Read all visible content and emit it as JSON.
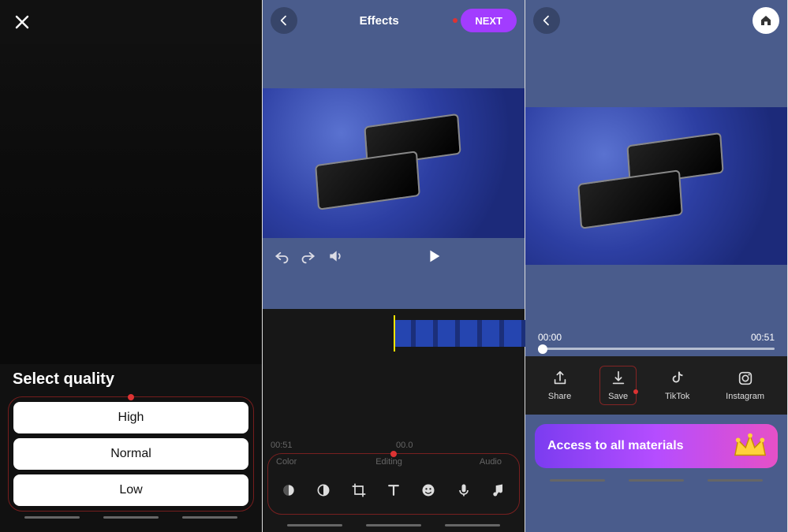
{
  "panel1": {
    "title": "Select quality",
    "options": [
      "High",
      "Normal",
      "Low"
    ]
  },
  "panel2": {
    "headerTitle": "Effects",
    "nextLabel": "NEXT",
    "timeLeft": "00:51",
    "timeRight": "00.0",
    "toolGroups": [
      "Color",
      "Editing",
      "Audio"
    ],
    "toolIcons": [
      "brightness",
      "contrast",
      "crop",
      "text",
      "emoji",
      "mic",
      "music"
    ]
  },
  "panel3": {
    "seekStart": "00:00",
    "seekEnd": "00:51",
    "share": {
      "share": "Share",
      "save": "Save",
      "tiktok": "TikTok",
      "instagram": "Instagram"
    },
    "bannerText": "Access to all materials"
  }
}
